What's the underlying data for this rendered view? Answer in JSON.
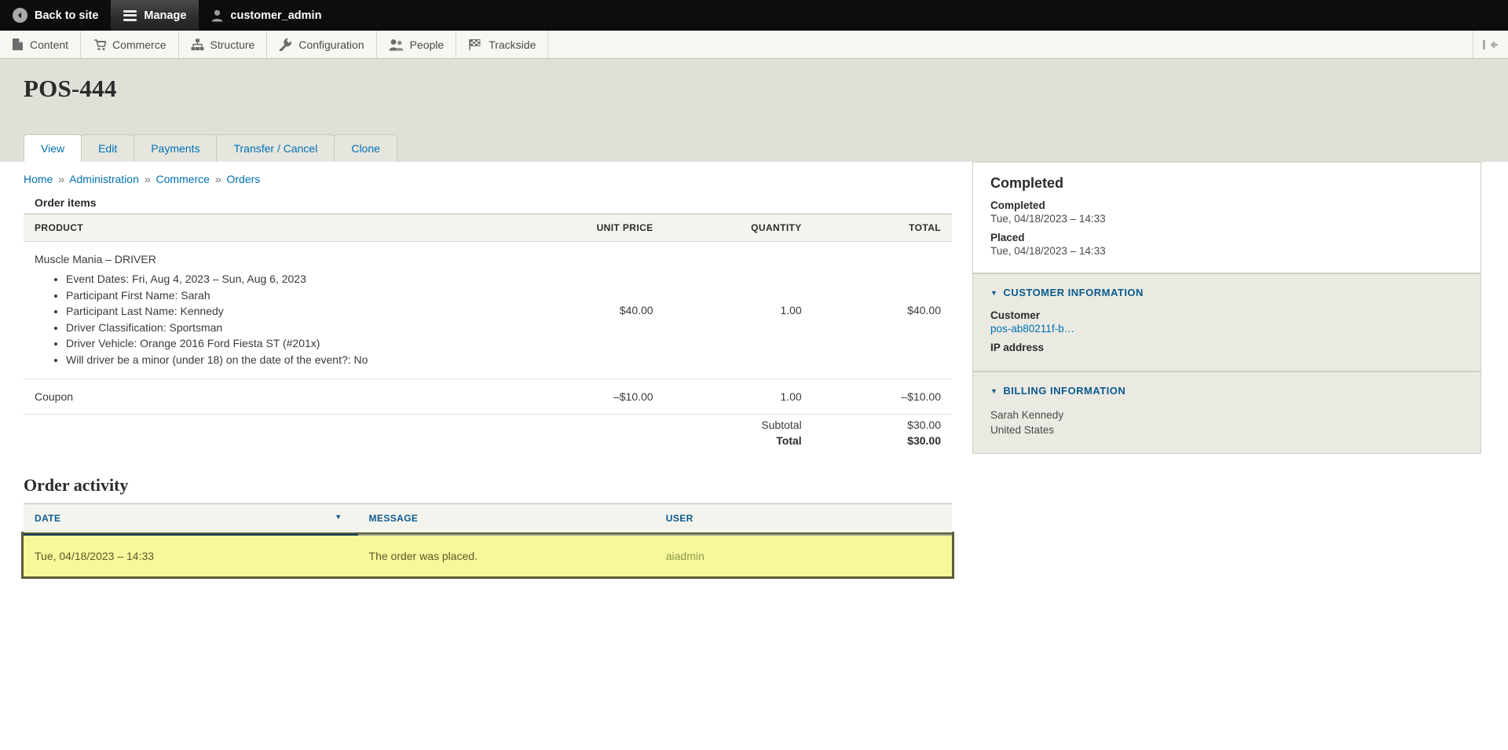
{
  "admin_bar": {
    "back_label": "Back to site",
    "back_icon": "back-circle-icon",
    "manage_label": "Manage",
    "manage_icon": "hamburger-icon",
    "user_label": "customer_admin",
    "user_icon": "user-icon"
  },
  "nav": {
    "items": [
      {
        "label": "Content",
        "icon": "document-icon",
        "name": "content"
      },
      {
        "label": "Commerce",
        "icon": "shopping-cart-icon",
        "name": "commerce"
      },
      {
        "label": "Structure",
        "icon": "sitemap-icon",
        "name": "structure"
      },
      {
        "label": "Configuration",
        "icon": "wrench-icon",
        "name": "configuration"
      },
      {
        "label": "People",
        "icon": "people-icon",
        "name": "people"
      },
      {
        "label": "Trackside",
        "icon": "checkered-flag-icon",
        "name": "trackside"
      }
    ],
    "toggle_icon": "collapse-toolbar-icon"
  },
  "header": {
    "title": "POS-444",
    "tabs": [
      {
        "label": "View",
        "active": true
      },
      {
        "label": "Edit",
        "active": false
      },
      {
        "label": "Payments",
        "active": false
      },
      {
        "label": "Transfer / Cancel",
        "active": false
      },
      {
        "label": "Clone",
        "active": false
      }
    ]
  },
  "breadcrumb": {
    "separator": "»",
    "items": [
      "Home",
      "Administration",
      "Commerce",
      "Orders"
    ]
  },
  "order_items": {
    "caption": "Order items",
    "columns": [
      "PRODUCT",
      "UNIT PRICE",
      "QUANTITY",
      "TOTAL"
    ],
    "rows": [
      {
        "product": "Muscle Mania – DRIVER",
        "attributes": [
          "Event Dates: Fri, Aug 4, 2023 – Sun, Aug 6, 2023",
          "Participant First Name: Sarah",
          "Participant Last Name: Kennedy",
          "Driver Classification: Sportsman",
          "Driver Vehicle: Orange 2016 Ford Fiesta ST (#201x)",
          "Will driver be a minor (under 18) on the date of the event?: No"
        ],
        "unit_price": "$40.00",
        "quantity": "1.00",
        "total": "$40.00"
      },
      {
        "product": "Coupon",
        "attributes": [],
        "unit_price": "–$10.00",
        "quantity": "1.00",
        "total": "–$10.00"
      }
    ],
    "totals": [
      {
        "label": "Subtotal",
        "value": "$30.00"
      },
      {
        "label": "Total",
        "value": "$30.00"
      }
    ]
  },
  "order_activity": {
    "heading": "Order activity",
    "columns": [
      "DATE",
      "MESSAGE",
      "USER"
    ],
    "sort_indicator": "▼",
    "rows": [
      {
        "date": "Tue, 04/18/2023 – 14:33",
        "message": "The order was placed.",
        "user": "aiadmin"
      }
    ]
  },
  "sidebar": {
    "status_panel": {
      "status": "Completed",
      "fields": [
        {
          "label": "Completed",
          "value": "Tue, 04/18/2023 – 14:33"
        },
        {
          "label": "Placed",
          "value": "Tue, 04/18/2023 – 14:33"
        }
      ]
    },
    "customer_panel": {
      "title": "CUSTOMER INFORMATION",
      "caret": "▼",
      "customer_label": "Customer",
      "customer_value": "pos-ab80211f-b…",
      "ip_label": "IP address",
      "ip_value": ""
    },
    "billing_panel": {
      "title": "BILLING INFORMATION",
      "caret": "▼",
      "lines": [
        "Sarah Kennedy",
        "United States"
      ]
    }
  },
  "colors": {
    "admin_bar_bg": "#0d0d0d",
    "header_bg": "#e0e0d8",
    "link": "#0071b3",
    "panel_heading": "#0b5a8e",
    "highlight_row": "#f8f79a",
    "highlight_border": "#5d5d38"
  }
}
